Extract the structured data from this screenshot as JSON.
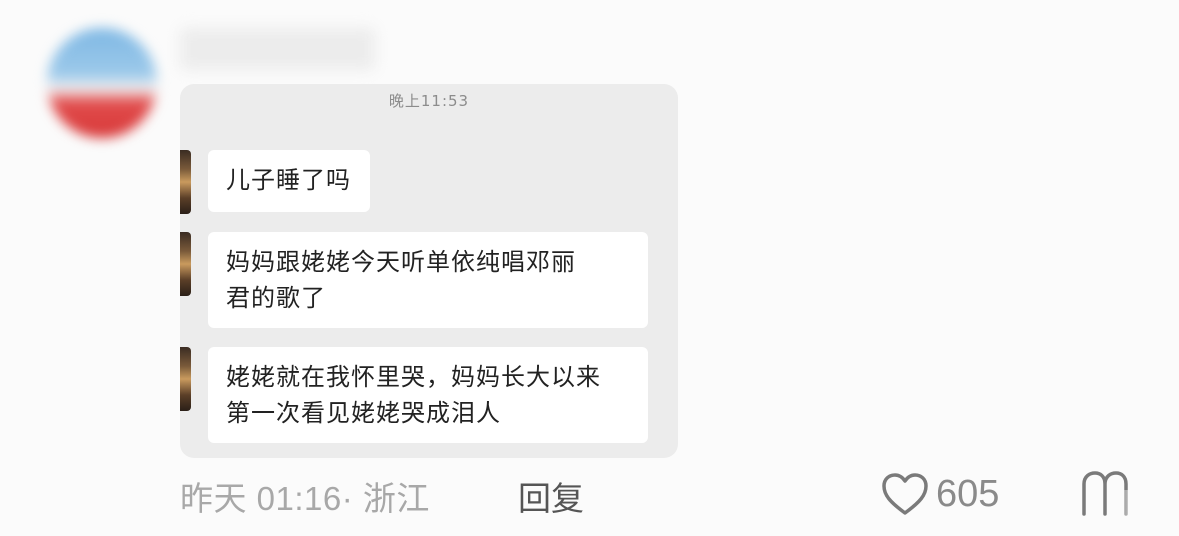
{
  "post": {
    "username": "",
    "image": {
      "timestamp": "晚上11:53",
      "messages": [
        {
          "lines": [
            "儿子睡了吗"
          ]
        },
        {
          "lines": [
            "妈妈跟姥姥今天听单依纯唱邓丽",
            "君的歌了"
          ]
        },
        {
          "lines": [
            "姥姥就在我怀里哭，妈妈长大以来",
            "第一次看见姥姥哭成泪人"
          ]
        }
      ]
    },
    "meta": "昨天 01:16· 浙江",
    "reply_label": "回复",
    "like_count": "605",
    "icons": {
      "like": "heart-outline-icon",
      "more": "more-icon"
    }
  }
}
